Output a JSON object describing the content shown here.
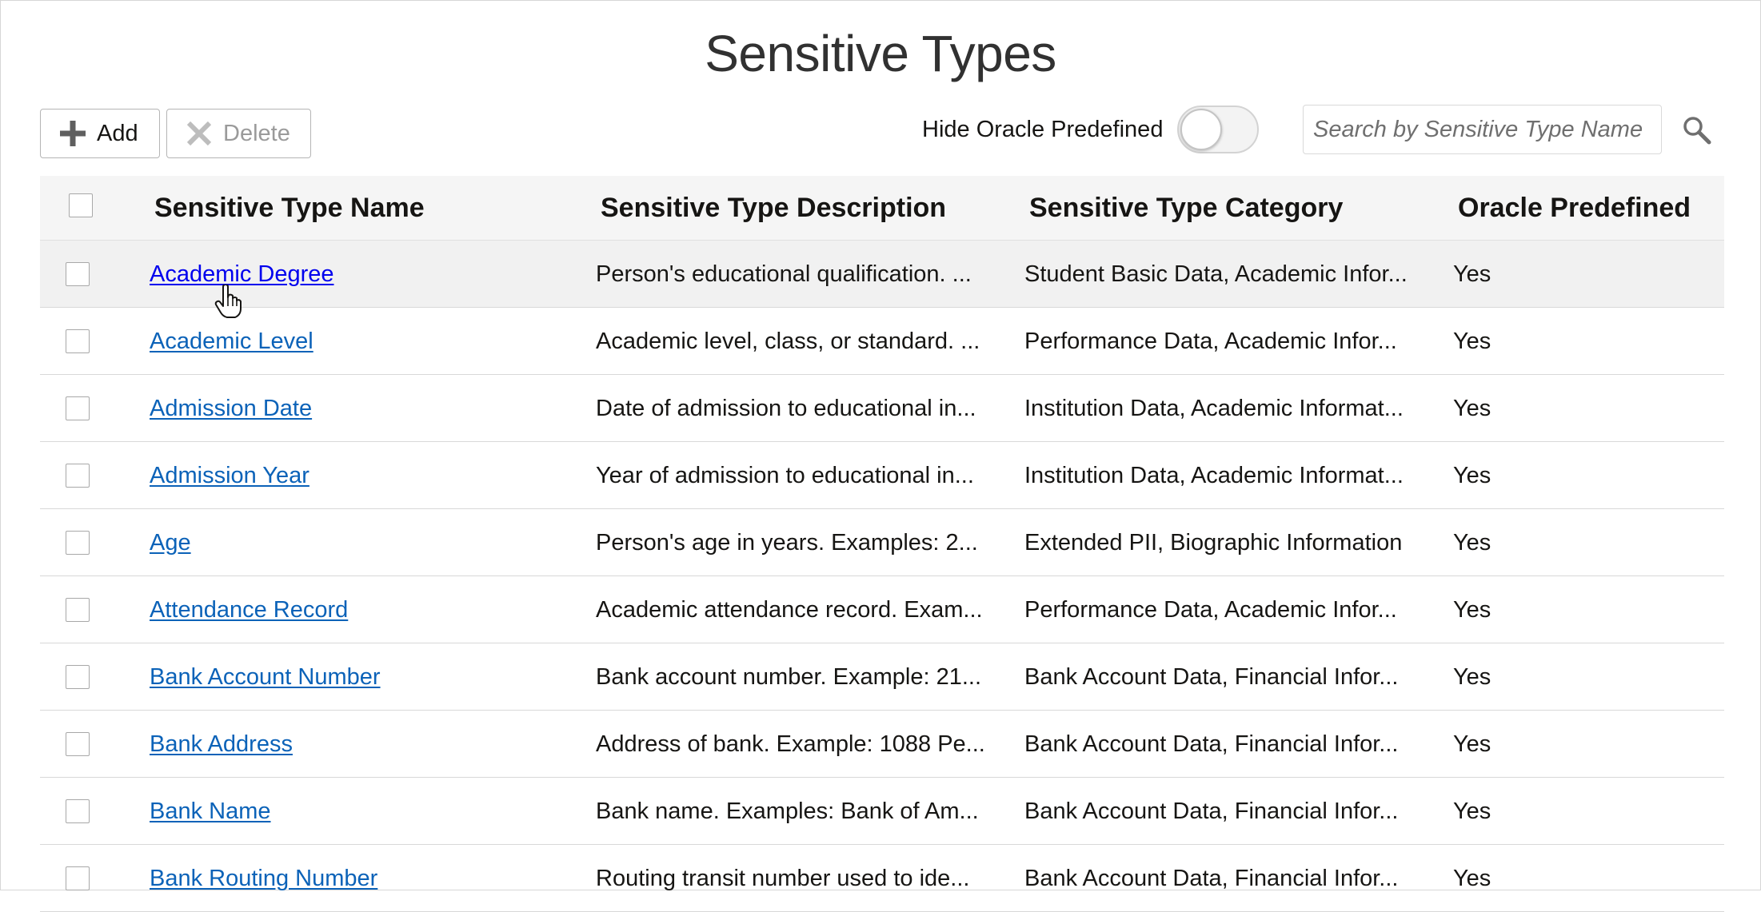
{
  "page": {
    "title": "Sensitive Types"
  },
  "toolbar": {
    "add_label": "Add",
    "delete_label": "Delete",
    "hide_predefined_label": "Hide Oracle Predefined",
    "hide_predefined_on": false,
    "search_placeholder": "Search by Sensitive Type Name",
    "search_value": ""
  },
  "table": {
    "columns": [
      "Sensitive Type Name",
      "Sensitive Type Description",
      "Sensitive Type Category",
      "Oracle Predefined"
    ],
    "rows": [
      {
        "name": "Academic Degree",
        "description": "Person's educational qualification. ...",
        "category": "Student Basic Data, Academic Infor...",
        "predefined": "Yes"
      },
      {
        "name": "Academic Level",
        "description": "Academic level, class, or standard. ...",
        "category": "Performance Data, Academic Infor...",
        "predefined": "Yes"
      },
      {
        "name": "Admission Date",
        "description": "Date of admission to educational in...",
        "category": "Institution Data, Academic Informat...",
        "predefined": "Yes"
      },
      {
        "name": "Admission Year",
        "description": "Year of admission to educational in...",
        "category": "Institution Data, Academic Informat...",
        "predefined": "Yes"
      },
      {
        "name": "Age",
        "description": "Person's age in years. Examples: 2...",
        "category": "Extended PII, Biographic Information",
        "predefined": "Yes"
      },
      {
        "name": "Attendance Record",
        "description": "Academic attendance record. Exam...",
        "category": "Performance Data, Academic Infor...",
        "predefined": "Yes"
      },
      {
        "name": "Bank Account Number",
        "description": "Bank account number. Example: 21...",
        "category": "Bank Account Data, Financial Infor...",
        "predefined": "Yes"
      },
      {
        "name": "Bank Address",
        "description": "Address of bank. Example: 1088 Pe...",
        "category": "Bank Account Data, Financial Infor...",
        "predefined": "Yes"
      },
      {
        "name": "Bank Name",
        "description": "Bank name. Examples: Bank of Am...",
        "category": "Bank Account Data, Financial Infor...",
        "predefined": "Yes"
      },
      {
        "name": "Bank Routing Number",
        "description": "Routing transit number used to ide...",
        "category": "Bank Account Data, Financial Infor...",
        "predefined": "Yes"
      }
    ]
  },
  "icons": {
    "add": "plus-icon",
    "delete": "x-icon",
    "search": "magnifier-icon",
    "cursor": "hand-pointer-icon"
  },
  "colors": {
    "link": "#0b62b8",
    "link_hover": "#0000ee",
    "header_bg": "#f5f5f5",
    "hover_row_bg": "#f1f1f1"
  }
}
